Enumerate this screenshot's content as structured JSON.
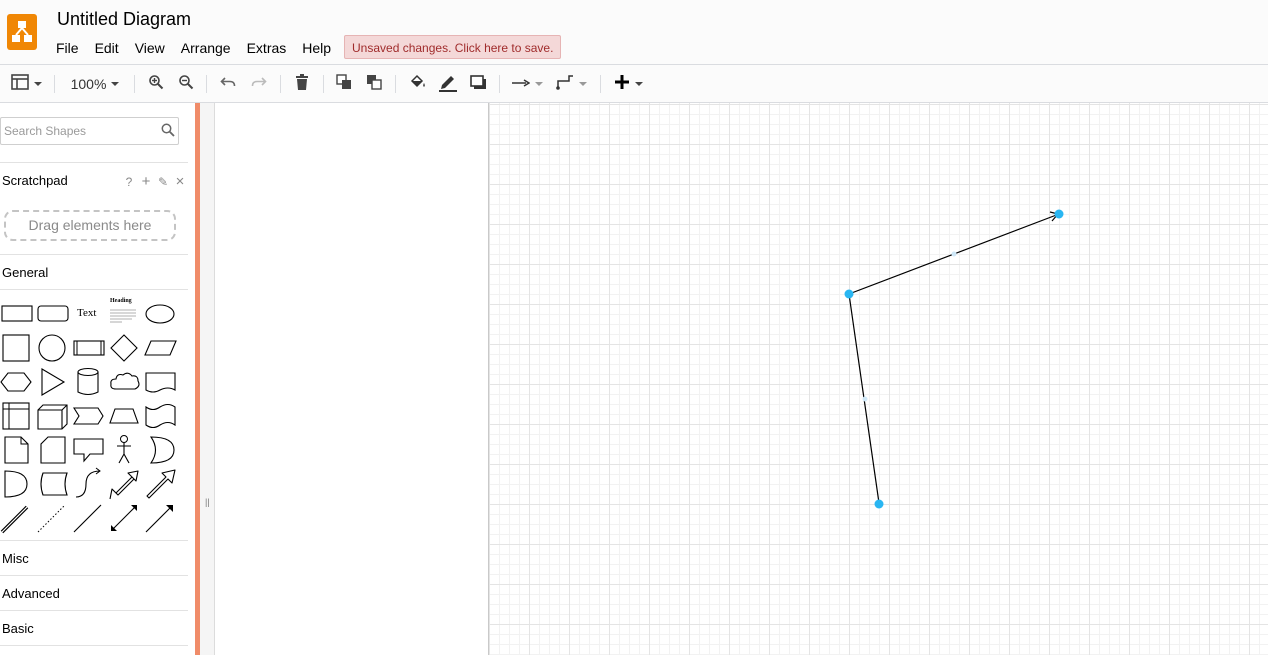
{
  "app": {
    "title": "Untitled Diagram",
    "accent_color": "#f08705",
    "logo_icon": "drawio-logo-icon"
  },
  "menu": {
    "items": [
      "File",
      "Edit",
      "View",
      "Arrange",
      "Extras",
      "Help"
    ],
    "unsaved_notice": "Unsaved changes. Click here to save."
  },
  "toolbar": {
    "zoom": "100%",
    "buttons": [
      "format-panel-icon",
      "zoom-in-icon",
      "zoom-out-icon",
      "undo-icon",
      "redo-icon",
      "delete-icon",
      "to-front-icon",
      "to-back-icon",
      "fill-color-icon",
      "line-color-icon",
      "shadow-icon",
      "connection-style-icon",
      "waypoints-icon",
      "insert-icon"
    ]
  },
  "sidebar": {
    "search_placeholder": "Search Shapes",
    "scratchpad": {
      "label": "Scratchpad",
      "tools": [
        "?",
        "+",
        "✎",
        "×"
      ],
      "drop_hint": "Drag elements here"
    },
    "sections": {
      "general": "General",
      "misc": "Misc",
      "advanced": "Advanced",
      "basic": "Basic"
    },
    "shape_text_label": "Text",
    "shape_heading_label": "Heading",
    "border_color": "#f08c69"
  },
  "diagram": {
    "edge_color": "#000000",
    "handle_color": "#29b6f2",
    "edge_selected": true
  }
}
